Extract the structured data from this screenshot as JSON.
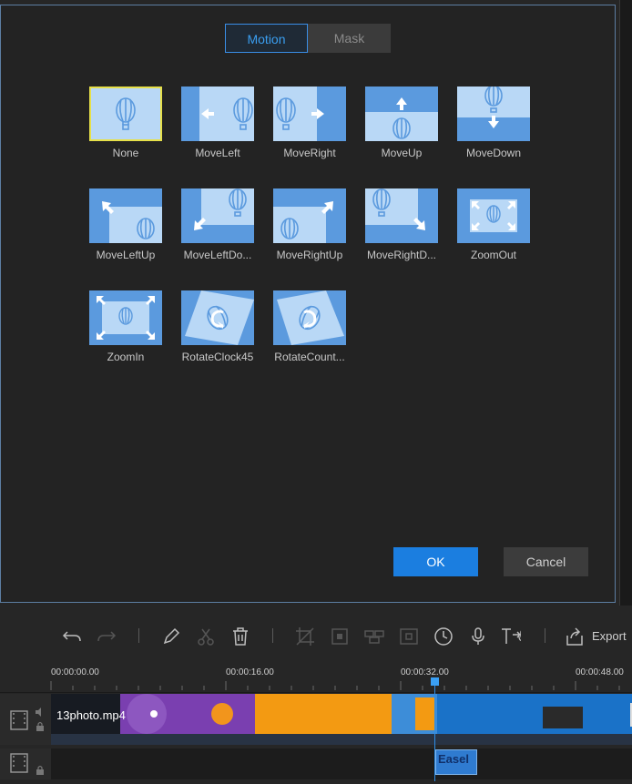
{
  "tabs": [
    {
      "label": "Motion",
      "active": true
    },
    {
      "label": "Mask",
      "active": false
    }
  ],
  "effects": [
    {
      "label": "None",
      "selected": true,
      "icon": "balloon-icon"
    },
    {
      "label": "MoveLeft",
      "icon": "arrow-left-icon"
    },
    {
      "label": "MoveRight",
      "icon": "arrow-right-icon"
    },
    {
      "label": "MoveUp",
      "icon": "arrow-up-icon"
    },
    {
      "label": "MoveDown",
      "icon": "arrow-down-icon"
    },
    {
      "label": "MoveLeftUp",
      "icon": "arrow-up-left-icon"
    },
    {
      "label": "MoveLeftDo...",
      "icon": "arrow-down-left-icon"
    },
    {
      "label": "MoveRightUp",
      "icon": "arrow-up-right-icon"
    },
    {
      "label": "MoveRightD...",
      "icon": "arrow-down-right-icon"
    },
    {
      "label": "ZoomOut",
      "icon": "zoom-out-icon"
    },
    {
      "label": "ZoomIn",
      "icon": "zoom-in-icon"
    },
    {
      "label": "RotateClock45",
      "icon": "rotate-clockwise-icon"
    },
    {
      "label": "RotateCount...",
      "icon": "rotate-counterclockwise-icon"
    }
  ],
  "buttons": {
    "ok": "OK",
    "cancel": "Cancel"
  },
  "toolbar": {
    "export_label": "Export",
    "icons": [
      "undo-icon",
      "redo-icon",
      "edit-icon",
      "cut-icon",
      "delete-icon",
      "crop-icon",
      "mosaic-icon",
      "split-screen-icon",
      "freeze-frame-icon",
      "speed-icon",
      "voiceover-icon",
      "text-to-speech-icon",
      "export-icon"
    ]
  },
  "timeline": {
    "ticks": [
      "00:00:00.00",
      "00:00:16.00",
      "00:00:32.00",
      "00:00:48.00"
    ],
    "clip_name": "13photo.mp4",
    "title_clip_text": "Easel",
    "accent": "#2e8ee6",
    "select_color": "#e6e04a"
  }
}
